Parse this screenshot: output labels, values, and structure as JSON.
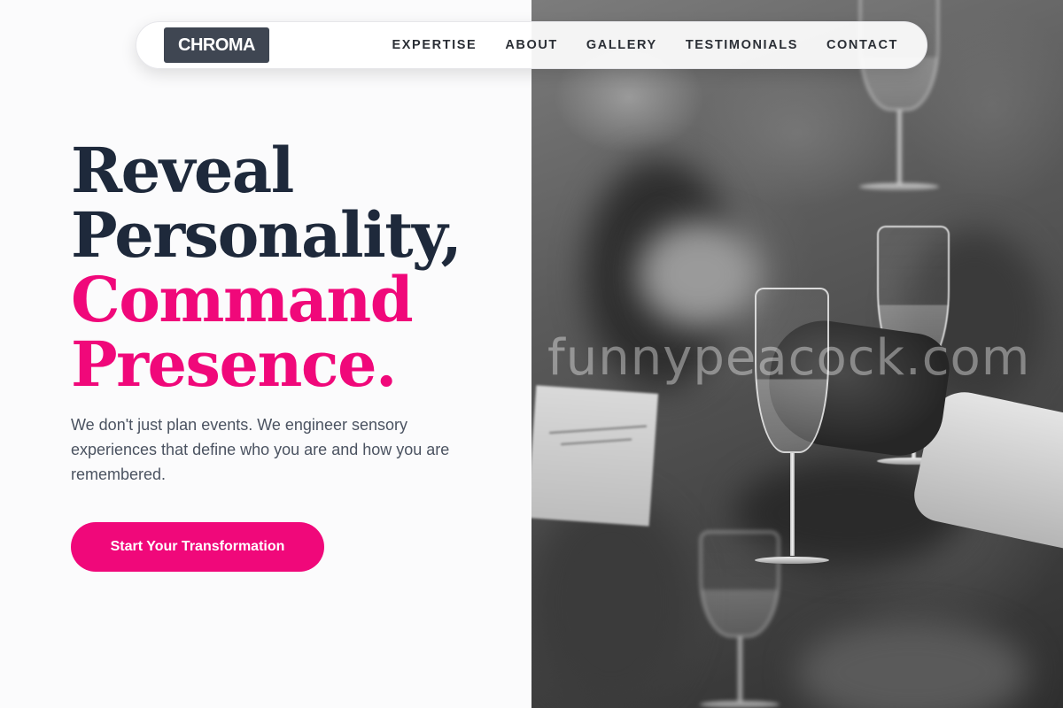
{
  "nav": {
    "logo": "CHROMA",
    "items": [
      "EXPERTISE",
      "ABOUT",
      "GALLERY",
      "TESTIMONIALS",
      "CONTACT"
    ]
  },
  "hero": {
    "headline": {
      "line1": "Reveal",
      "line2": "Personality,",
      "line3": "Command",
      "line4": "Presence."
    },
    "subtext": "We don't just plan events. We engineer sensory experiences that define who you are and how you are remembered.",
    "cta_label": "Start Your Transformation"
  },
  "photo": {
    "watermark": "funnypeacock.com"
  },
  "colors": {
    "accent": "#f0087a",
    "heading": "#1e293b",
    "logo_bg": "#3f4652"
  }
}
